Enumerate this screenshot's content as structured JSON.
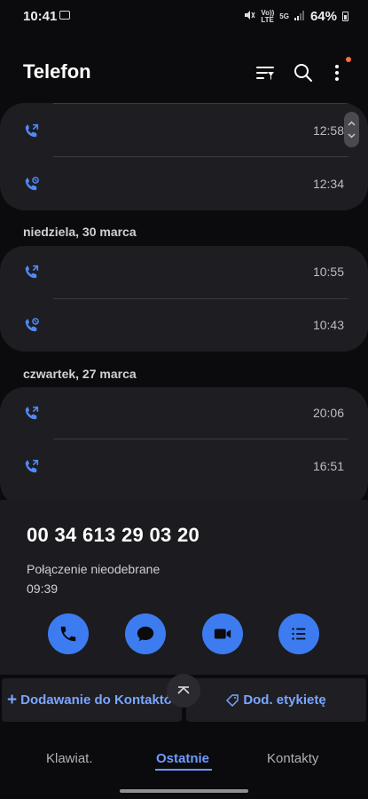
{
  "status_bar": {
    "time": "10:41",
    "volte": "Vo))",
    "lte": "LTE",
    "net": "5G",
    "battery": "64%"
  },
  "header": {
    "title": "Telefon",
    "icons": [
      "filter-icon",
      "search-icon",
      "more-options-icon"
    ]
  },
  "groups": [
    {
      "date": "",
      "calls": [
        {
          "icon": "outgoing-call-icon",
          "time": "12:58"
        },
        {
          "icon": "missed-call-icon",
          "time": "12:34"
        }
      ]
    },
    {
      "date": "niedziela, 30 marca",
      "calls": [
        {
          "icon": "outgoing-call-icon",
          "time": "10:55"
        },
        {
          "icon": "missed-call-icon",
          "time": "10:43"
        }
      ]
    },
    {
      "date": "czwartek, 27 marca",
      "calls": [
        {
          "icon": "outgoing-call-icon",
          "time": "20:06"
        },
        {
          "icon": "outgoing-call-icon",
          "time": "16:51"
        }
      ]
    }
  ],
  "detail": {
    "number": "00 34 613 29 03 20",
    "status": "Połączenie nieodebrane",
    "time": "09:39",
    "actions": [
      "call-icon",
      "message-icon",
      "video-call-icon",
      "details-icon"
    ]
  },
  "bottom_actions": {
    "add_contact": "Dodawanie do Kontaktów",
    "add_tag": "Dod. etykietę"
  },
  "tabs": [
    "Klawiat.",
    "Ostatnie",
    "Kontakty"
  ],
  "active_tab": "Ostatnie",
  "colors": {
    "accent": "#3d7cf0",
    "card": "#1d1d22",
    "background": "#0b0b0d"
  }
}
